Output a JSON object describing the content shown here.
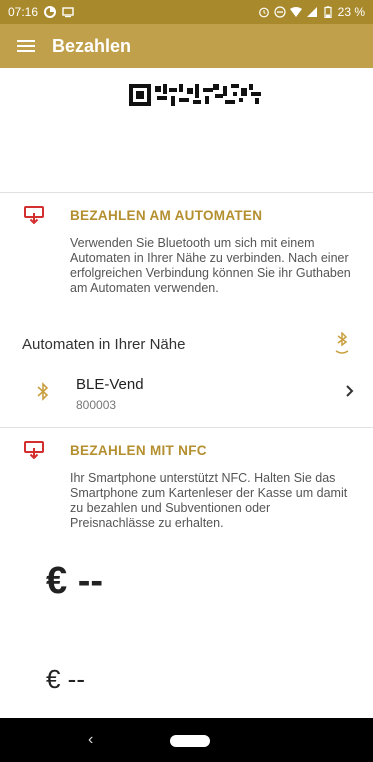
{
  "status_bar": {
    "time": "07:16",
    "battery": "23 %",
    "bg_color": "#a8892c",
    "icons": [
      "data-saver-icon",
      "cast-icon",
      "alarm-icon",
      "dnd-icon",
      "wifi-icon",
      "signal-icon",
      "battery-icon"
    ]
  },
  "app_bar": {
    "title": "Bezahlen",
    "menu_icon": "hamburger-menu-icon",
    "bg_color": "#c0a04a"
  },
  "automat_section": {
    "icon": "payment-terminal-icon",
    "title": "BEZAHLEN AM AUTOMATEN",
    "text": "Verwenden Sie Bluetooth um sich mit einem Automaten in Ihrer Nähe zu verbinden. Nach einer erfolgreichen Verbindung können Sie ihr Guthaben am Automaten verwenden."
  },
  "nearby": {
    "label": "Automaten in Ihrer Nähe",
    "scan_icon": "bluetooth-searching-icon"
  },
  "device": {
    "icon": "bluetooth-icon",
    "name": "BLE-Vend",
    "id": "800003",
    "chevron_icon": "chevron-right-icon"
  },
  "nfc_section": {
    "icon": "payment-terminal-icon",
    "title": "BEZAHLEN MIT NFC",
    "text": "Ihr Smartphone unterstützt NFC. Halten Sie das Smartphone zum Kartenleser der Kasse um damit zu bezahlen und Subventionen oder Preisnachlässe zu erhalten."
  },
  "balances": {
    "primary": "€ --",
    "secondary": "€ --"
  },
  "nav_bar": {
    "back_icon": "back-chevron-icon",
    "home_icon": "home-pill-icon",
    "back_glyph": "‹"
  },
  "colors": {
    "accent": "#b48f2f",
    "icon_red": "#d32f2f",
    "bluetooth": "#c9a040"
  }
}
